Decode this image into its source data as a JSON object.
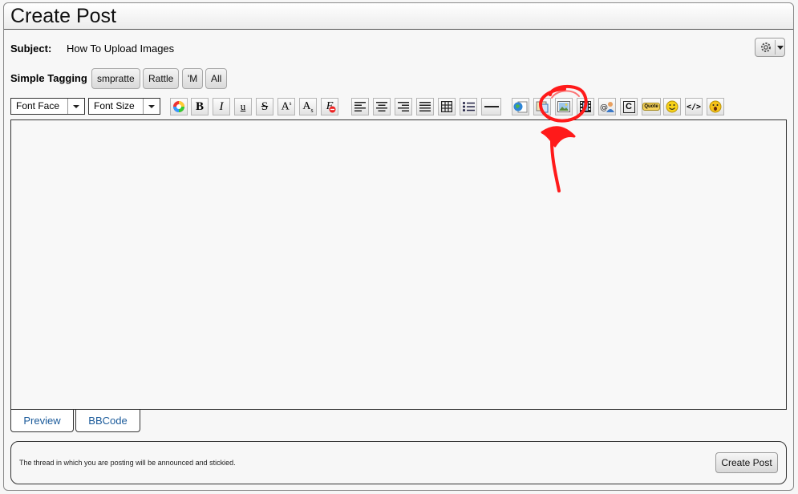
{
  "header": {
    "title": "Create Post"
  },
  "subject": {
    "label": "Subject:",
    "value": "How To Upload Images"
  },
  "tagging": {
    "label": "Simple Tagging",
    "tags": [
      "smpratte",
      "Rattle",
      "'M",
      "All"
    ]
  },
  "toolbar": {
    "font_face": "Font Face",
    "font_size": "Font Size",
    "glyphs": {
      "bold": "B",
      "italic": "I",
      "underline": "u",
      "strike": "S",
      "superscript": "A",
      "sup_s": "s",
      "subscript": "A",
      "sub_s": "s",
      "remove_format": "F",
      "copyright": "C",
      "quote": "Quote",
      "code": "</>"
    }
  },
  "editor": {
    "content": ""
  },
  "tabs": [
    {
      "label": "Preview"
    },
    {
      "label": "BBCode"
    }
  ],
  "footer": {
    "note": "The thread in which you are posting will be announced and stickied.",
    "submit_label": "Create Post"
  },
  "colors": {
    "annotation": "#ff1a1a",
    "link": "#1a5a9a"
  }
}
